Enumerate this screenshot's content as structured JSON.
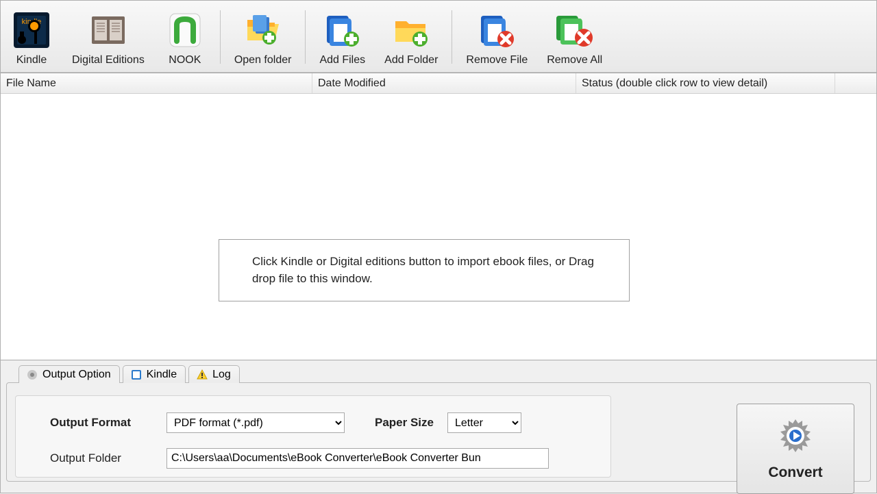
{
  "toolbar": {
    "kindle": "Kindle",
    "digital_editions": "Digital Editions",
    "nook": "NOOK",
    "open_folder": "Open folder",
    "add_files": "Add Files",
    "add_folder": "Add Folder",
    "remove_file": "Remove File",
    "remove_all": "Remove All"
  },
  "columns": {
    "file_name": "File Name",
    "date_modified": "Date Modified",
    "status": "Status (double click row to view detail)"
  },
  "placeholder": "Click Kindle or Digital editions button to import ebook files, or Drag drop file to this window.",
  "tabs": {
    "output_option": "Output Option",
    "kindle": "Kindle",
    "log": "Log"
  },
  "form": {
    "output_format_label": "Output Format",
    "output_format_value": "PDF format (*.pdf)",
    "paper_size_label": "Paper Size",
    "paper_size_value": "Letter",
    "output_folder_label": "Output Folder",
    "output_folder_value": "C:\\Users\\aa\\Documents\\eBook Converter\\eBook Converter Bun"
  },
  "convert_label": "Convert"
}
